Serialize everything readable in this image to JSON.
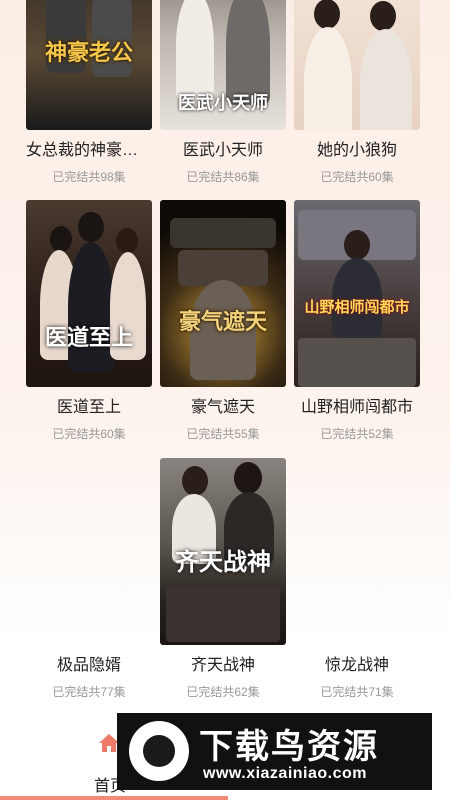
{
  "cards": [
    {
      "title": "女总裁的神豪老…",
      "status": "已完结共98集",
      "poster_text": "神豪老公"
    },
    {
      "title": "医武小天师",
      "status": "已完结共86集",
      "poster_text": "医武小天师"
    },
    {
      "title": "她的小狼狗",
      "status": "已完结共60集",
      "poster_text": ""
    },
    {
      "title": "医道至上",
      "status": "已完结共60集",
      "poster_text": "医道至上"
    },
    {
      "title": "豪气遮天",
      "status": "已完结共55集",
      "poster_text": "豪气遮天"
    },
    {
      "title": "山野相师闯都市",
      "status": "已完结共52集",
      "poster_text": "山野相师闯都市"
    },
    {
      "title": "极品隐婿",
      "status": "已完结共77集",
      "poster_text": ""
    },
    {
      "title": "齐天战神",
      "status": "已完结共62集",
      "poster_text": "齐天战神"
    },
    {
      "title": "惊龙战神",
      "status": "已完结共71集",
      "poster_text": ""
    }
  ],
  "nav": {
    "home_label": "首页"
  },
  "watermark": {
    "title": "下载鸟资源",
    "url": "www.xiazainiao.com"
  },
  "colors": {
    "accent": "#f08a7a",
    "text": "#222222",
    "muted": "#999999"
  }
}
